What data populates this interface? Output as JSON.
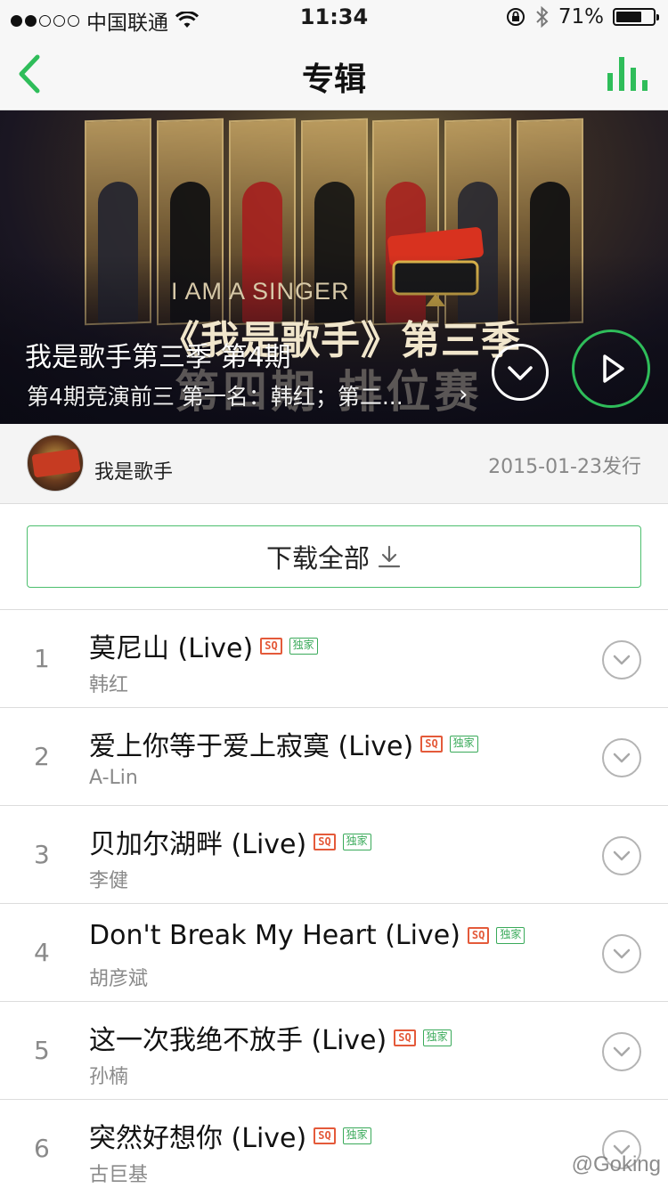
{
  "status_bar": {
    "carrier": "中国联通",
    "time": "11:34",
    "battery": "71%",
    "battery_level": 0.71,
    "signal_bars_filled": 2
  },
  "nav": {
    "title": "专辑",
    "back_icon": "chevron-left-icon",
    "right_icon": "equalizer-icon",
    "accent_color": "#2fbd5a"
  },
  "banner": {
    "deco_english": "I AM A SINGER",
    "deco_show": "《我是歌手》第三季",
    "deco_episode": "第四期 排位赛",
    "album_title": "我是歌手第三季 第4期",
    "album_desc": "第4期竞演前三 第一名：韩红；第二...",
    "desc_chevron": "›"
  },
  "info": {
    "artist": "我是歌手",
    "release_date": "2015-01-23发行"
  },
  "download": {
    "label": "下载全部"
  },
  "tags": {
    "sq": "SQ",
    "exclusive": "独家",
    "sq_color": "#e45a3a",
    "exclusive_color": "#3aaa5a"
  },
  "tracks": [
    {
      "num": "1",
      "title": "莫尼山 (Live)",
      "artist": "韩红"
    },
    {
      "num": "2",
      "title": "爱上你等于爱上寂寞 (Live)",
      "artist": "A-Lin"
    },
    {
      "num": "3",
      "title": "贝加尔湖畔 (Live)",
      "artist": "李健"
    },
    {
      "num": "4",
      "title": "Don't Break My Heart (Live)",
      "artist": "胡彦斌"
    },
    {
      "num": "5",
      "title": "这一次我绝不放手 (Live)",
      "artist": "孙楠"
    },
    {
      "num": "6",
      "title": "突然好想你 (Live)",
      "artist": "古巨基"
    }
  ],
  "watermark": "@Goking"
}
